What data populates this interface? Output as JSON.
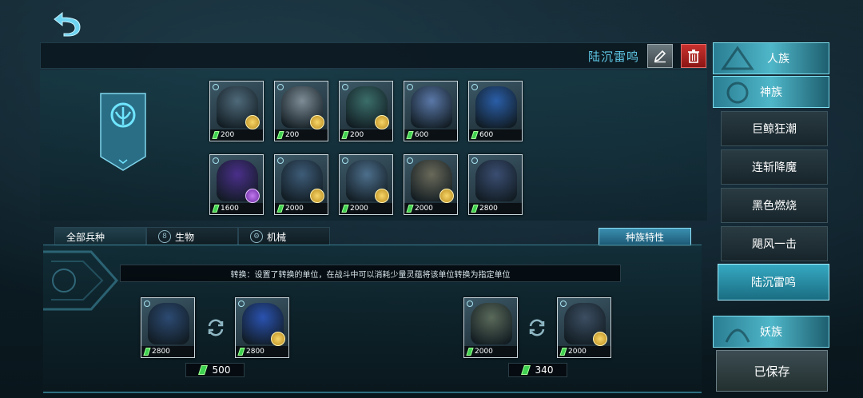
{
  "header": {
    "deck_name": "陆沉雷鸣"
  },
  "units_row1": [
    {
      "cost": "200",
      "color": "#4f6a7a",
      "badge": "gold"
    },
    {
      "cost": "200",
      "color": "#7d8c96",
      "badge": "gold"
    },
    {
      "cost": "200",
      "color": "#3b6e6a",
      "badge": "gold"
    },
    {
      "cost": "600",
      "color": "#5a78a8",
      "badge": "none"
    },
    {
      "cost": "600",
      "color": "#2a5ea8",
      "badge": "none"
    }
  ],
  "units_row2": [
    {
      "cost": "1600",
      "color": "#4a2f8a",
      "badge": "purple"
    },
    {
      "cost": "2000",
      "color": "#3e5c78",
      "badge": "gold"
    },
    {
      "cost": "2000",
      "color": "#4d6f8c",
      "badge": "gold"
    },
    {
      "cost": "2000",
      "color": "#6a6a5a",
      "badge": "gold"
    },
    {
      "cost": "2800",
      "color": "#3b4e72",
      "badge": "none"
    }
  ],
  "tabs": {
    "all": "全部兵种",
    "bio": "生物",
    "mech": "机械",
    "bio_icon": "8",
    "mech_icon": "⚙"
  },
  "race_trait": "种族特性",
  "description": "转换：设置了转换的单位，在战斗中可以消耗少量灵蕴将该单位转换为指定单位",
  "conversions": [
    {
      "from_cost": "2800",
      "to_cost": "2800",
      "price": "500"
    },
    {
      "from_cost": "2000",
      "to_cost": "2000",
      "price": "340"
    }
  ],
  "races": {
    "human": "人族",
    "god": "神族",
    "decks": [
      "巨鲸狂潮",
      "连斩降魔",
      "黑色燃烧",
      "飓风一击",
      "陆沉雷鸣"
    ],
    "demon": "妖族",
    "saved": "已保存"
  }
}
